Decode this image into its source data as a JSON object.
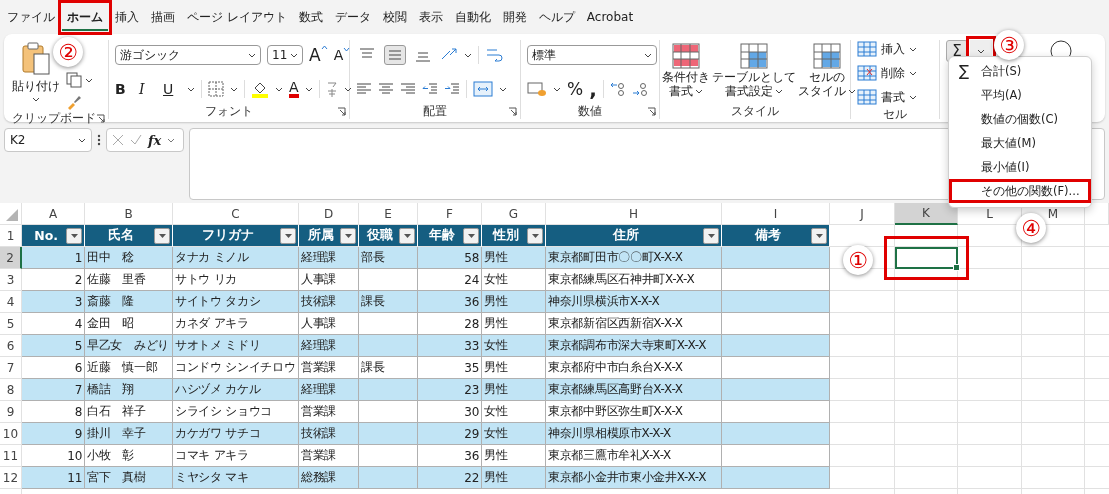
{
  "tabs": [
    {
      "label": "ファイル",
      "selected": false
    },
    {
      "label": "ホーム",
      "selected": true
    },
    {
      "label": "挿入",
      "selected": false
    },
    {
      "label": "描画",
      "selected": false
    },
    {
      "label": "ページ レイアウト",
      "selected": false
    },
    {
      "label": "数式",
      "selected": false
    },
    {
      "label": "データ",
      "selected": false
    },
    {
      "label": "校閲",
      "selected": false
    },
    {
      "label": "表示",
      "selected": false
    },
    {
      "label": "自動化",
      "selected": false
    },
    {
      "label": "開発",
      "selected": false
    },
    {
      "label": "ヘルプ",
      "selected": false
    },
    {
      "label": "Acrobat",
      "selected": false
    }
  ],
  "ribbon": {
    "groups": [
      {
        "kind": "clipboard",
        "label": "クリップボード",
        "paste": "貼り付け"
      },
      {
        "kind": "font",
        "label": "フォント",
        "font_name": "游ゴシック",
        "font_size": "11",
        "grow": "A",
        "shrink": "A",
        "bold": "B",
        "italic": "I",
        "underline": "U",
        "font_color": "A"
      },
      {
        "kind": "alignment",
        "label": "配置",
        "vertical": [
          {
            "selected": false
          },
          {
            "selected": true
          },
          {
            "selected": false
          }
        ]
      },
      {
        "kind": "number",
        "label": "数値",
        "format": "標準",
        "percent": "%",
        "comma": ","
      },
      {
        "kind": "styles",
        "label": "スタイル",
        "buttons": [
          {
            "lines": [
              "条件付き",
              "書式"
            ]
          },
          {
            "lines": [
              "テーブルとして",
              "書式設定"
            ]
          },
          {
            "lines": [
              "セルの",
              "スタイル"
            ]
          }
        ]
      },
      {
        "kind": "cells",
        "label": "セル",
        "buttons": [
          "挿入",
          "削除",
          "書式"
        ]
      },
      {
        "kind": "editing",
        "sum": "Σ"
      }
    ]
  },
  "formula_bar": {
    "name_box": "K2",
    "fx": "fx"
  },
  "columns": [
    {
      "label": "A",
      "selected": false
    },
    {
      "label": "B",
      "selected": false
    },
    {
      "label": "C",
      "selected": false
    },
    {
      "label": "D",
      "selected": false
    },
    {
      "label": "E",
      "selected": false
    },
    {
      "label": "F",
      "selected": false
    },
    {
      "label": "G",
      "selected": false
    },
    {
      "label": "H",
      "selected": false
    },
    {
      "label": "I",
      "selected": false
    },
    {
      "label": "J",
      "selected": false
    },
    {
      "label": "K",
      "selected": true
    },
    {
      "label": "L",
      "selected": false
    },
    {
      "label": "M",
      "selected": false
    }
  ],
  "row_headers": [
    {
      "label": "1",
      "selected": false
    },
    {
      "label": "2",
      "selected": true
    },
    {
      "label": "3",
      "selected": false
    },
    {
      "label": "4",
      "selected": false
    },
    {
      "label": "5",
      "selected": false
    },
    {
      "label": "6",
      "selected": false
    },
    {
      "label": "7",
      "selected": false
    },
    {
      "label": "8",
      "selected": false
    },
    {
      "label": "9",
      "selected": false
    },
    {
      "label": "10",
      "selected": false
    },
    {
      "label": "11",
      "selected": false
    },
    {
      "label": "12",
      "selected": false
    }
  ],
  "table": {
    "columns": [
      "No.",
      "氏名",
      "フリガナ",
      "所属",
      "役職",
      "年齢",
      "性別",
      "住所",
      "備考"
    ],
    "rows": [
      [
        "1",
        "田中　稔",
        "タナカ ミノル",
        "経理課",
        "部長",
        "58",
        "男性",
        "東京都町田市〇〇町X-X-X",
        null
      ],
      [
        "2",
        "佐藤　里香",
        "サトウ リカ",
        "人事課",
        null,
        "24",
        "女性",
        "東京都練馬区石神井町X-X-X",
        null
      ],
      [
        "3",
        "斎藤　隆",
        "サイトウ タカシ",
        "技術課",
        "課長",
        "36",
        "男性",
        "神奈川県横浜市X-X-X",
        null
      ],
      [
        "4",
        "金田　昭",
        "カネダ アキラ",
        "人事課",
        null,
        "28",
        "男性",
        "東京都新宿区西新宿X-X-X",
        null
      ],
      [
        "5",
        "早乙女　みどり",
        "サオトメ ミドリ",
        "経理課",
        null,
        "33",
        "女性",
        "東京都調布市深大寺東町X-X-X",
        null
      ],
      [
        "6",
        "近藤　慎一郎",
        "コンドウ シンイチロウ",
        "営業課",
        "課長",
        "35",
        "男性",
        "東京都府中市白糸台X-X-X",
        null
      ],
      [
        "7",
        "橋詰　翔",
        "ハシヅメ カケル",
        "経理課",
        null,
        "23",
        "男性",
        "東京都練馬区高野台X-X-X",
        null
      ],
      [
        "8",
        "白石　祥子",
        "シライシ ショウコ",
        "営業課",
        null,
        "30",
        "女性",
        "東京都中野区弥生町X-X-X",
        null
      ],
      [
        "9",
        "掛川　幸子",
        "カケガワ サチコ",
        "技術課",
        null,
        "29",
        "女性",
        "神奈川県相模原市X-X-X",
        null
      ],
      [
        "10",
        "小牧　彰",
        "コマキ アキラ",
        "営業課",
        null,
        "36",
        "男性",
        "東京都三鷹市牟礼X-X-X",
        null
      ],
      [
        "11",
        "宮下　真樹",
        "ミヤシタ マキ",
        "総務課",
        null,
        "22",
        "男性",
        "東京都小金井市東小金井X-X-X",
        null
      ]
    ]
  },
  "menu": {
    "items": [
      {
        "label": "合計(S)",
        "symbol": "∑"
      },
      {
        "label": "平均(A)"
      },
      {
        "label": "数値の個数(C)"
      },
      {
        "label": "最大値(M)"
      },
      {
        "label": "最小値(I)"
      },
      {
        "label": "その他の関数(F)..."
      }
    ]
  },
  "callouts": [
    "①",
    "②",
    "③",
    "④"
  ]
}
